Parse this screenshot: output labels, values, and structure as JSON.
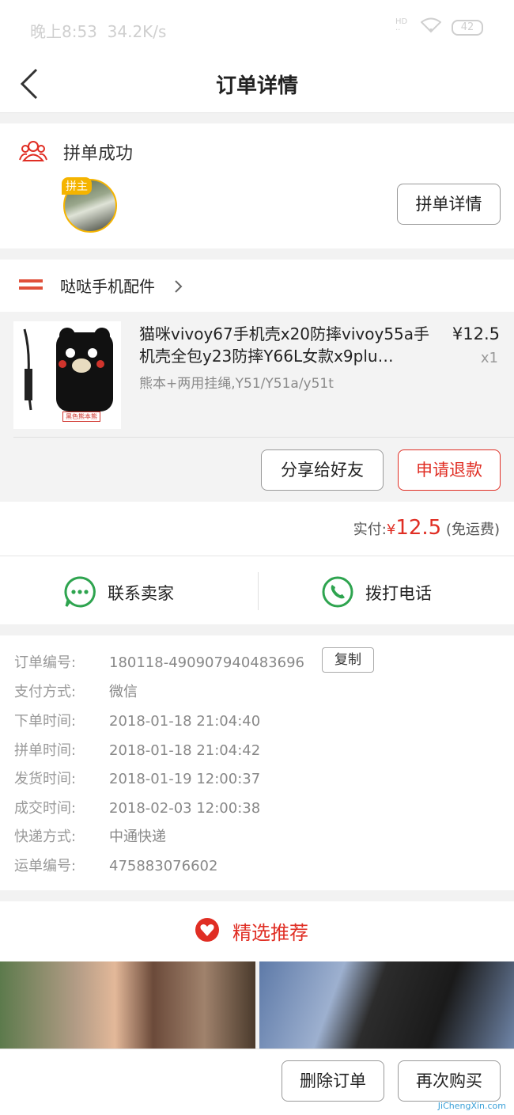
{
  "status_bar": {
    "time": "晚上8:53",
    "speed": "34.2K/s",
    "battery": "42"
  },
  "nav": {
    "title": "订单详情"
  },
  "group": {
    "status": "拼单成功",
    "host_badge": "拼主",
    "detail_button": "拼单详情"
  },
  "shop": {
    "name": "哒哒手机配件"
  },
  "product": {
    "title": "猫咪vivoy67手机壳x20防摔vivoy55a手机壳全包y23防摔Y66L女款x9plu…",
    "spec": "熊本+两用挂绳,Y51/Y51a/y51t",
    "price": "¥12.5",
    "qty": "x1",
    "image_label": "黑色熊本熊",
    "share_button": "分享给好友",
    "refund_button": "申请退款"
  },
  "payment": {
    "label": "实付:",
    "currency": "¥",
    "amount": "12.5",
    "note": "(免运费)"
  },
  "contact": {
    "seller": "联系卖家",
    "phone": "拨打电话"
  },
  "order_info": {
    "copy_button": "复制",
    "rows": [
      {
        "key": "订单编号:",
        "value": "180118-490907940483696"
      },
      {
        "key": "支付方式:",
        "value": "微信"
      },
      {
        "key": "下单时间:",
        "value": "2018-01-18 21:04:40"
      },
      {
        "key": "拼单时间:",
        "value": "2018-01-18 21:04:42"
      },
      {
        "key": "发货时间:",
        "value": "2018-01-19 12:00:37"
      },
      {
        "key": "成交时间:",
        "value": "2018-02-03 12:00:38"
      },
      {
        "key": "快递方式:",
        "value": "中通快递"
      },
      {
        "key": "运单编号:",
        "value": "475883076602"
      }
    ]
  },
  "recommend": {
    "title": "精选推荐"
  },
  "bottom": {
    "delete_button": "删除订单",
    "rebuy_button": "再次购买"
  },
  "watermark": {
    "text": "JiChengXin.com"
  },
  "colors": {
    "accent": "#e02e24",
    "wechat_green": "#2ea44f"
  }
}
